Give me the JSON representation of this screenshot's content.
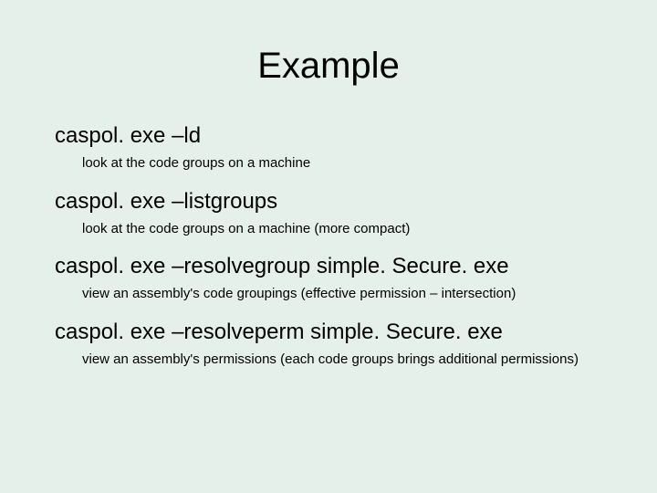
{
  "title": "Example",
  "items": [
    {
      "cmd": "caspol. exe –ld",
      "desc": "look at the code groups on a machine"
    },
    {
      "cmd": "caspol. exe –listgroups",
      "desc": "look at the code groups on a machine (more compact)"
    },
    {
      "cmd": "caspol. exe –resolvegroup simple. Secure. exe",
      "desc": "view an assembly's code groupings  (effective permission – intersection)"
    },
    {
      "cmd": "caspol. exe –resolveperm simple. Secure. exe",
      "desc": "view an assembly's permissions (each code groups brings additional permissions)"
    }
  ]
}
